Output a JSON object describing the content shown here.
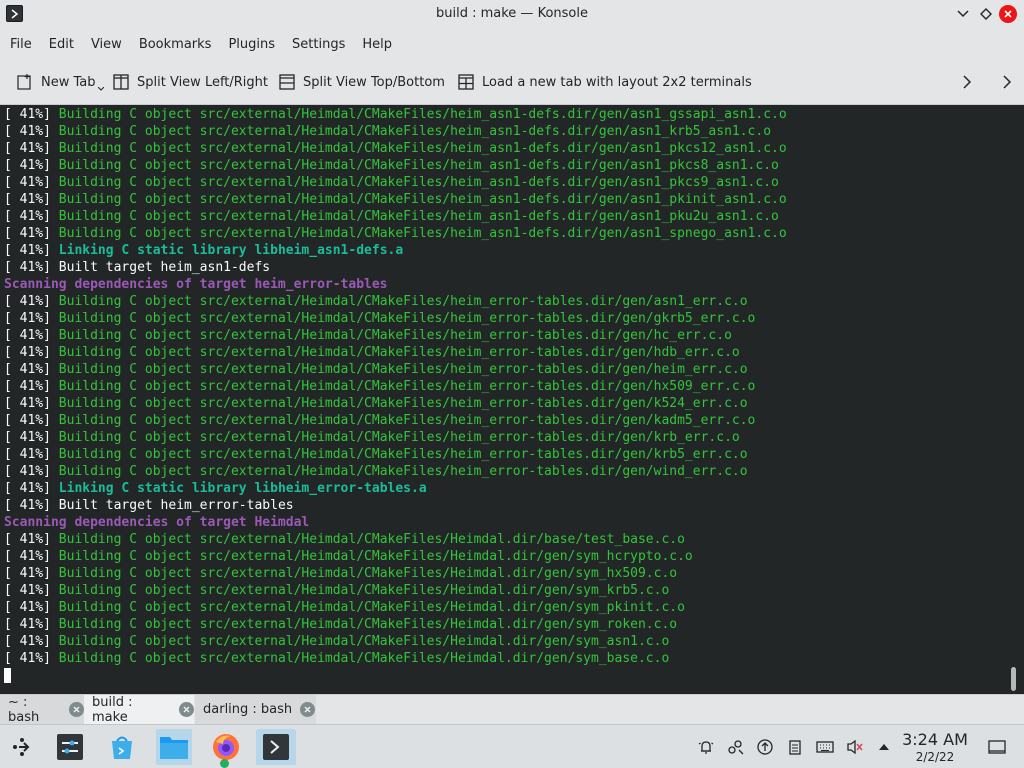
{
  "window": {
    "title": "build : make — Konsole"
  },
  "menubar": {
    "items": [
      "File",
      "Edit",
      "View",
      "Bookmarks",
      "Plugins",
      "Settings",
      "Help"
    ]
  },
  "toolbar": {
    "new_tab": "New Tab",
    "split_lr": "Split View Left/Right",
    "split_tb": "Split View Top/Bottom",
    "layout_2x2": "Load a new tab with layout 2x2 terminals"
  },
  "terminal": {
    "lines": [
      {
        "prefix": "[ 41%] ",
        "text": "Building C object src/external/Heimdal/CMakeFiles/heim_asn1-defs.dir/gen/asn1_gssapi_asn1.c.o",
        "style": "g"
      },
      {
        "prefix": "[ 41%] ",
        "text": "Building C object src/external/Heimdal/CMakeFiles/heim_asn1-defs.dir/gen/asn1_krb5_asn1.c.o",
        "style": "g"
      },
      {
        "prefix": "[ 41%] ",
        "text": "Building C object src/external/Heimdal/CMakeFiles/heim_asn1-defs.dir/gen/asn1_pkcs12_asn1.c.o",
        "style": "g"
      },
      {
        "prefix": "[ 41%] ",
        "text": "Building C object src/external/Heimdal/CMakeFiles/heim_asn1-defs.dir/gen/asn1_pkcs8_asn1.c.o",
        "style": "g"
      },
      {
        "prefix": "[ 41%] ",
        "text": "Building C object src/external/Heimdal/CMakeFiles/heim_asn1-defs.dir/gen/asn1_pkcs9_asn1.c.o",
        "style": "g"
      },
      {
        "prefix": "[ 41%] ",
        "text": "Building C object src/external/Heimdal/CMakeFiles/heim_asn1-defs.dir/gen/asn1_pkinit_asn1.c.o",
        "style": "g"
      },
      {
        "prefix": "[ 41%] ",
        "text": "Building C object src/external/Heimdal/CMakeFiles/heim_asn1-defs.dir/gen/asn1_pku2u_asn1.c.o",
        "style": "g"
      },
      {
        "prefix": "[ 41%] ",
        "text": "Building C object src/external/Heimdal/CMakeFiles/heim_asn1-defs.dir/gen/asn1_spnego_asn1.c.o",
        "style": "g"
      },
      {
        "prefix": "[ 41%] ",
        "text": "Linking C static library libheim_asn1-defs.a",
        "style": "tc"
      },
      {
        "prefix": "[ 41%] ",
        "text": "Built target heim_asn1-defs",
        "style": "w"
      },
      {
        "prefix": "",
        "text": "Scanning dependencies of target heim_error-tables",
        "style": "pr"
      },
      {
        "prefix": "[ 41%] ",
        "text": "Building C object src/external/Heimdal/CMakeFiles/heim_error-tables.dir/gen/asn1_err.c.o",
        "style": "g"
      },
      {
        "prefix": "[ 41%] ",
        "text": "Building C object src/external/Heimdal/CMakeFiles/heim_error-tables.dir/gen/gkrb5_err.c.o",
        "style": "g"
      },
      {
        "prefix": "[ 41%] ",
        "text": "Building C object src/external/Heimdal/CMakeFiles/heim_error-tables.dir/gen/hc_err.c.o",
        "style": "g"
      },
      {
        "prefix": "[ 41%] ",
        "text": "Building C object src/external/Heimdal/CMakeFiles/heim_error-tables.dir/gen/hdb_err.c.o",
        "style": "g"
      },
      {
        "prefix": "[ 41%] ",
        "text": "Building C object src/external/Heimdal/CMakeFiles/heim_error-tables.dir/gen/heim_err.c.o",
        "style": "g"
      },
      {
        "prefix": "[ 41%] ",
        "text": "Building C object src/external/Heimdal/CMakeFiles/heim_error-tables.dir/gen/hx509_err.c.o",
        "style": "g"
      },
      {
        "prefix": "[ 41%] ",
        "text": "Building C object src/external/Heimdal/CMakeFiles/heim_error-tables.dir/gen/k524_err.c.o",
        "style": "g"
      },
      {
        "prefix": "[ 41%] ",
        "text": "Building C object src/external/Heimdal/CMakeFiles/heim_error-tables.dir/gen/kadm5_err.c.o",
        "style": "g"
      },
      {
        "prefix": "[ 41%] ",
        "text": "Building C object src/external/Heimdal/CMakeFiles/heim_error-tables.dir/gen/krb_err.c.o",
        "style": "g"
      },
      {
        "prefix": "[ 41%] ",
        "text": "Building C object src/external/Heimdal/CMakeFiles/heim_error-tables.dir/gen/krb5_err.c.o",
        "style": "g"
      },
      {
        "prefix": "[ 41%] ",
        "text": "Building C object src/external/Heimdal/CMakeFiles/heim_error-tables.dir/gen/wind_err.c.o",
        "style": "g"
      },
      {
        "prefix": "[ 41%] ",
        "text": "Linking C static library libheim_error-tables.a",
        "style": "tc"
      },
      {
        "prefix": "[ 41%] ",
        "text": "Built target heim_error-tables",
        "style": "w"
      },
      {
        "prefix": "",
        "text": "Scanning dependencies of target Heimdal",
        "style": "pr"
      },
      {
        "prefix": "[ 41%] ",
        "text": "Building C object src/external/Heimdal/CMakeFiles/Heimdal.dir/base/test_base.c.o",
        "style": "g"
      },
      {
        "prefix": "[ 41%] ",
        "text": "Building C object src/external/Heimdal/CMakeFiles/Heimdal.dir/gen/sym_hcrypto.c.o",
        "style": "g"
      },
      {
        "prefix": "[ 41%] ",
        "text": "Building C object src/external/Heimdal/CMakeFiles/Heimdal.dir/gen/sym_hx509.c.o",
        "style": "g"
      },
      {
        "prefix": "[ 41%] ",
        "text": "Building C object src/external/Heimdal/CMakeFiles/Heimdal.dir/gen/sym_krb5.c.o",
        "style": "g"
      },
      {
        "prefix": "[ 41%] ",
        "text": "Building C object src/external/Heimdal/CMakeFiles/Heimdal.dir/gen/sym_pkinit.c.o",
        "style": "g"
      },
      {
        "prefix": "[ 41%] ",
        "text": "Building C object src/external/Heimdal/CMakeFiles/Heimdal.dir/gen/sym_roken.c.o",
        "style": "g"
      },
      {
        "prefix": "[ 41%] ",
        "text": "Building C object src/external/Heimdal/CMakeFiles/Heimdal.dir/gen/sym_asn1.c.o",
        "style": "g"
      },
      {
        "prefix": "[ 41%] ",
        "text": "Building C object src/external/Heimdal/CMakeFiles/Heimdal.dir/gen/sym_base.c.o",
        "style": "g"
      }
    ]
  },
  "tabs": [
    {
      "label": "~ : bash",
      "active": false
    },
    {
      "label": "build : make",
      "active": true
    },
    {
      "label": "darling : bash",
      "active": false
    }
  ],
  "taskbar": {
    "apps": [
      "launcher-icon",
      "system-settings-icon",
      "discover-icon",
      "file-manager-icon",
      "firefox-icon",
      "konsole-icon"
    ],
    "tray": [
      "notifications-icon",
      "network-icon",
      "updates-icon",
      "clipboard-icon",
      "keyboard-icon",
      "volume-muted-icon",
      "expand-tray-icon"
    ],
    "clock_time": "3:24 AM",
    "clock_date": "2/2/22"
  },
  "colors": {
    "terminal_bg": "#232627",
    "build_green": "#33c43a",
    "link_teal": "#1abc9c",
    "scan_purple": "#9b59b6",
    "accent": "#3daee9"
  }
}
